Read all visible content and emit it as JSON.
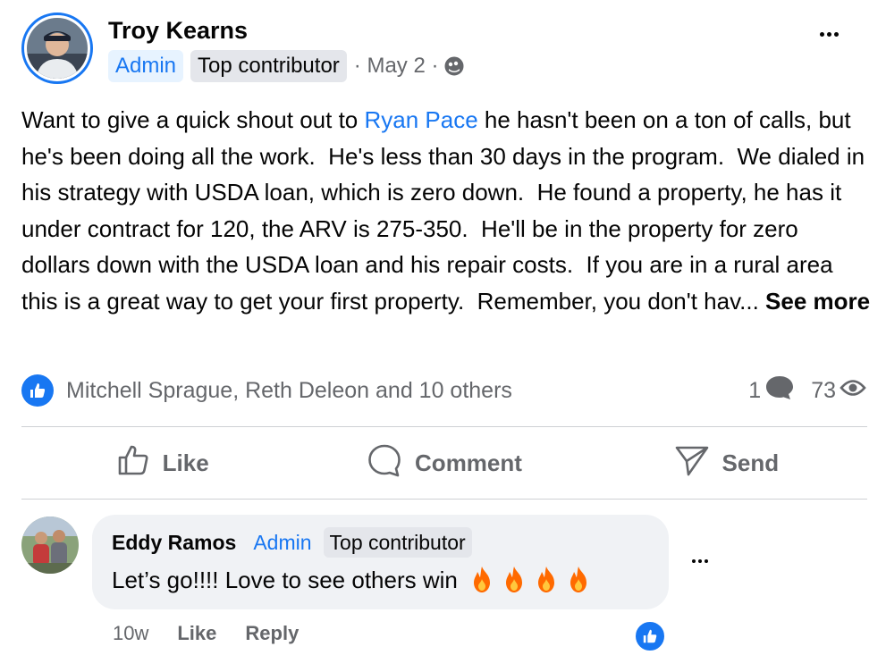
{
  "post": {
    "author": "Troy Kearns",
    "badges": {
      "admin": "Admin",
      "top": "Top contributor"
    },
    "date": "· May 2 ·",
    "privacy_icon": "globe-icon",
    "text_before_mention": "Want to give a quick shout out to ",
    "mention": "Ryan Pace",
    "text_after_mention": " he hasn't been on a ton of calls, but he's been doing all the work.  He's less than 30 days in the program.  We dialed in his strategy with USDA loan, which is zero down.  He found a property, he has it under contract for 120, the ARV is 275-350.  He'll be in the property for zero dollars down with the USDA loan and his repair costs.  If you are in a rural area this is a great way to get your first property.  Remember, you don't hav... ",
    "see_more": "See more"
  },
  "reactions": {
    "summary": "Mitchell Sprague, Reth Deleon and 10 others",
    "comments_count": "1",
    "views_count": "73"
  },
  "actions": {
    "like": "Like",
    "comment": "Comment",
    "send": "Send"
  },
  "comment": {
    "author": "Eddy Ramos",
    "badges": {
      "admin": "Admin",
      "top": "Top contributor"
    },
    "text": "Let’s go!!!! Love to see others win",
    "emoji_count": 4,
    "time": "10w",
    "like": "Like",
    "reply": "Reply"
  },
  "colors": {
    "accent": "#1877f2",
    "secondary_text": "#65676b",
    "fire": "#ff6a00"
  }
}
